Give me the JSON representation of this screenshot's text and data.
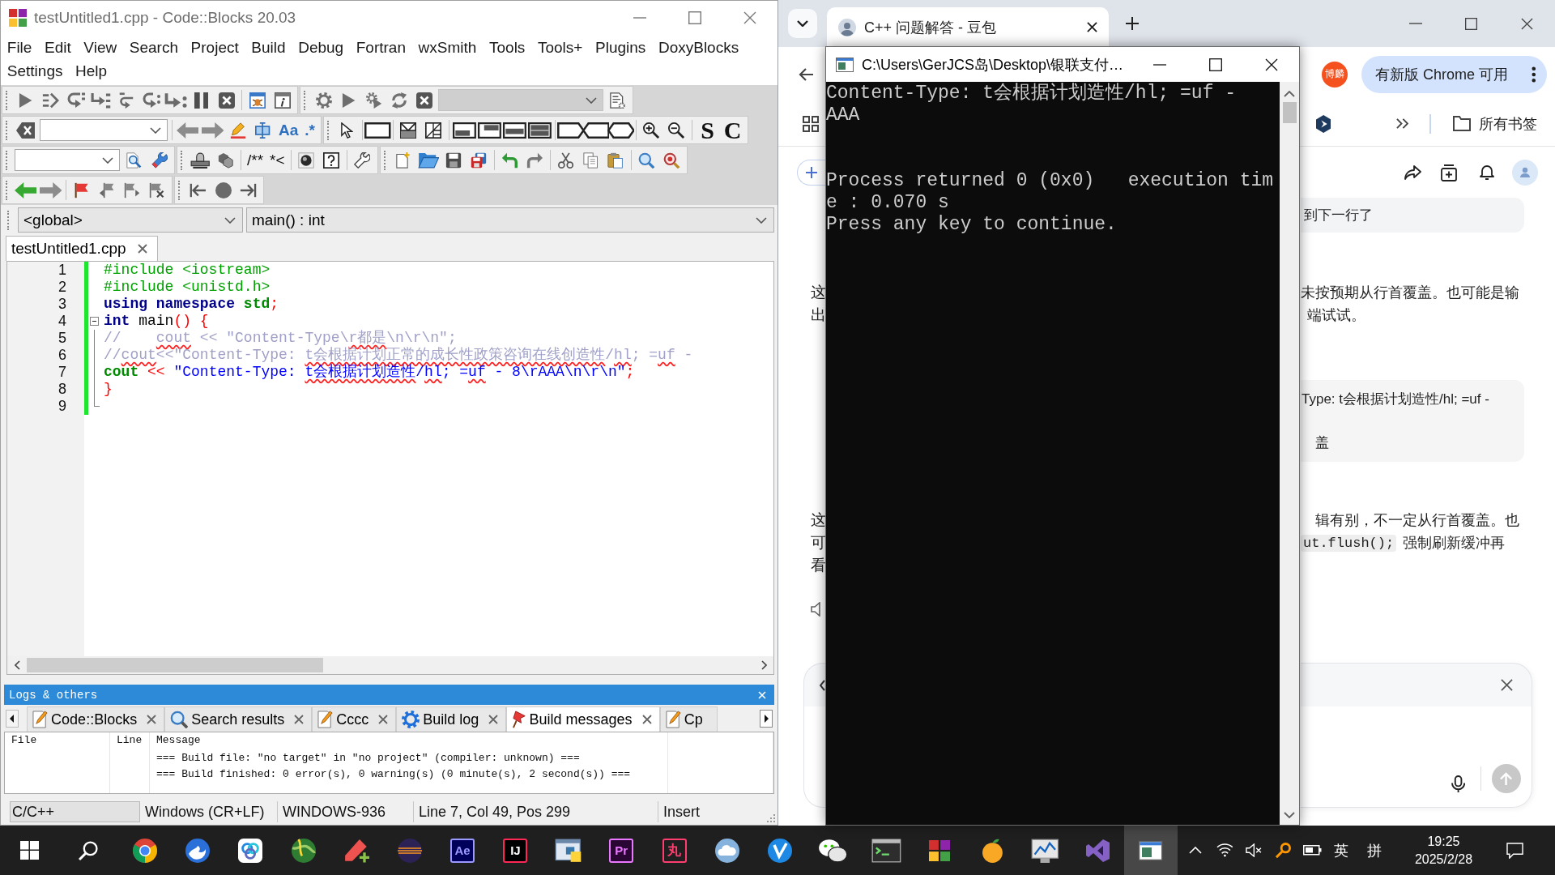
{
  "ide": {
    "title": "testUntitled1.cpp - Code::Blocks 20.03",
    "menu": [
      "File",
      "Edit",
      "View",
      "Search",
      "Project",
      "Build",
      "Debug",
      "Fortran",
      "wxSmith",
      "Tools",
      "Tools+",
      "Plugins",
      "DoxyBlocks",
      "Settings",
      "Help"
    ],
    "toolbars": {
      "target_combo": {
        "disabled": true
      },
      "search_options": [
        "Aa",
        ".*"
      ],
      "comment_buttons": [
        "/**",
        "*<"
      ],
      "letter_buttons": [
        "S",
        "C"
      ]
    },
    "scope_bar": {
      "scope": "<global>",
      "function": "main() : int"
    },
    "editor": {
      "tabs": [
        {
          "label": "testUntitled1.cpp",
          "selected": true
        }
      ],
      "lines": [
        {
          "number": "1",
          "changed": true,
          "tokens": [
            {
              "text": "#include <iostream>",
              "kind": "preprocessor",
              "flagged": false
            }
          ]
        },
        {
          "number": "2",
          "changed": true,
          "tokens": [
            {
              "text": "#include <unistd.h>",
              "kind": "preprocessor",
              "flagged": false
            }
          ]
        },
        {
          "number": "3",
          "changed": true,
          "tokens": [
            {
              "text": "using namespace ",
              "kind": "keyword",
              "flagged": false
            },
            {
              "text": "std",
              "kind": "identifier",
              "flagged": false
            },
            {
              "text": ";",
              "kind": "operator",
              "flagged": false
            }
          ]
        },
        {
          "number": "4",
          "changed": true,
          "expanded": true,
          "tokens": [
            {
              "text": "int",
              "kind": "keyword",
              "flagged": false
            },
            {
              "text": " main",
              "kind": "plain",
              "flagged": false
            },
            {
              "text": "()",
              "kind": "operator",
              "flagged": false
            },
            {
              "text": " {",
              "kind": "operator",
              "flagged": false
            }
          ],
          "children": [
            {
              "number": "5",
              "changed": true,
              "tokens": [
                {
                  "text": "//    ",
                  "kind": "comment",
                  "flagged": false
                },
                {
                  "text": "cout",
                  "kind": "comment",
                  "flagged": true
                },
                {
                  "text": " << \"Content-Type\\",
                  "kind": "comment",
                  "flagged": false
                },
                {
                  "text": "r都是",
                  "kind": "comment",
                  "flagged": true
                },
                {
                  "text": "\\n\\r\\n\";",
                  "kind": "comment",
                  "flagged": false
                }
              ]
            },
            {
              "number": "6",
              "changed": true,
              "tokens": [
                {
                  "text": "//",
                  "kind": "comment",
                  "flagged": false
                },
                {
                  "text": "cout",
                  "kind": "comment",
                  "flagged": true
                },
                {
                  "text": "<<\"Content-Type: ",
                  "kind": "comment",
                  "flagged": false
                },
                {
                  "text": "t会根据计划正常的成长性政策咨询在线创造性",
                  "kind": "comment",
                  "flagged": true
                },
                {
                  "text": "/",
                  "kind": "comment",
                  "flagged": false
                },
                {
                  "text": "hl",
                  "kind": "comment",
                  "flagged": true
                },
                {
                  "text": "; =",
                  "kind": "comment",
                  "flagged": false
                },
                {
                  "text": "uf",
                  "kind": "comment",
                  "flagged": true
                },
                {
                  "text": " -",
                  "kind": "comment",
                  "flagged": false
                }
              ]
            },
            {
              "number": "7",
              "changed": true,
              "tokens": [
                {
                  "text": "cout",
                  "kind": "identifier",
                  "flagged": false
                },
                {
                  "text": " <<",
                  "kind": "operator",
                  "flagged": false
                },
                {
                  "text": " \"Content-Type: ",
                  "kind": "string",
                  "flagged": false
                },
                {
                  "text": "t会根据计划造性",
                  "kind": "string",
                  "flagged": true
                },
                {
                  "text": "/",
                  "kind": "string",
                  "flagged": false
                },
                {
                  "text": "hl",
                  "kind": "string",
                  "flagged": true
                },
                {
                  "text": "; =",
                  "kind": "string",
                  "flagged": false
                },
                {
                  "text": "uf",
                  "kind": "string",
                  "flagged": true
                },
                {
                  "text": " - 8\\rAAA\\n\\r\\n\"",
                  "kind": "string",
                  "flagged": false
                },
                {
                  "text": ";",
                  "kind": "operator",
                  "flagged": false
                }
              ]
            },
            {
              "number": "8",
              "changed": true,
              "tokens": [
                {
                  "text": "}",
                  "kind": "operator",
                  "flagged": false
                }
              ]
            },
            {
              "number": "9",
              "changed": true
            }
          ]
        }
      ]
    },
    "logs": {
      "title": "Logs & others",
      "tabs": [
        {
          "label": "Code::Blocks",
          "kind": "document",
          "selected": false,
          "close_button": true
        },
        {
          "label": "Search results",
          "kind": "search",
          "selected": false,
          "close_button": true
        },
        {
          "label": "Cccc",
          "kind": "document",
          "selected": false,
          "close_button": true
        },
        {
          "label": "Build log",
          "kind": "build",
          "selected": false,
          "close_button": true
        },
        {
          "label": "Build messages",
          "kind": "messages",
          "selected": true,
          "close_button": true
        },
        {
          "label": "Cp",
          "kind": "document",
          "selected": false,
          "close_button": false
        }
      ],
      "columns": [
        "File",
        "Line",
        "Message"
      ],
      "rows": [
        {
          "message": "=== Build file: \"no target\" in \"no project\" (compiler: unknown) ==="
        },
        {
          "message": "=== Build finished: 0 error(s), 0 warning(s) (0 minute(s), 2 second(s)) ==="
        }
      ]
    },
    "status_bar": [
      "C/C++",
      "Windows (CR+LF)",
      "WINDOWS-936",
      "Line 7, Col 49, Pos 299",
      "Insert"
    ]
  },
  "browser": {
    "tabs": [
      {
        "title": "C++ 问题解答 - 豆包",
        "selected": true
      }
    ],
    "profile_badge": "博麟",
    "update_button": "有新版 Chrome 可用",
    "bookmarks_folder": "所有书签",
    "page": {
      "bubble": "到下一行了",
      "paragraph_1": {
        "left": [
          "这",
          "出"
        ],
        "right": [
          "未按预期从行首覆盖。也可能是输",
          "端试试。"
        ]
      },
      "code_block": [
        "Type: t会根据计划造性/hl; =uf -",
        "盖"
      ],
      "paragraph_2": {
        "left": [
          "这",
          "可",
          "看"
        ],
        "right": "辑有别，不一定从行首覆盖。也",
        "inline_code": "ut.flush();",
        "after_code": "强制刷新缓冲再"
      }
    }
  },
  "console": {
    "title": "C:\\Users\\GerJCS岛\\Desktop\\银联支付…",
    "blocks": [
      [
        "Content-Type: t会根据计划造性/hl; =uf -",
        "AAA"
      ],
      [
        "Process returned 0 (0x0)   execution tim",
        "e : 0.070 s",
        "Press any key to continue."
      ]
    ]
  },
  "taskbar": {
    "apps": [
      {
        "selected": false
      },
      {
        "selected": false
      },
      {
        "selected": false
      },
      {
        "selected": false
      },
      {
        "selected": false
      },
      {
        "selected": false
      },
      {
        "label": "Ae",
        "selected": false
      },
      {
        "label": "IJ",
        "selected": false
      },
      {
        "selected": false
      },
      {
        "label": "Pr",
        "selected": false
      },
      {
        "label": "丸",
        "selected": false
      },
      {
        "selected": false
      },
      {
        "selected": false
      },
      {
        "selected": false
      },
      {
        "selected": false
      },
      {
        "selected": false
      },
      {
        "selected": false
      },
      {
        "selected": false
      },
      {
        "selected": false
      },
      {
        "selected": true
      }
    ],
    "tray": {
      "language": "英",
      "input_mode": "拼",
      "time": "19:25",
      "date": "2025/2/28"
    }
  }
}
